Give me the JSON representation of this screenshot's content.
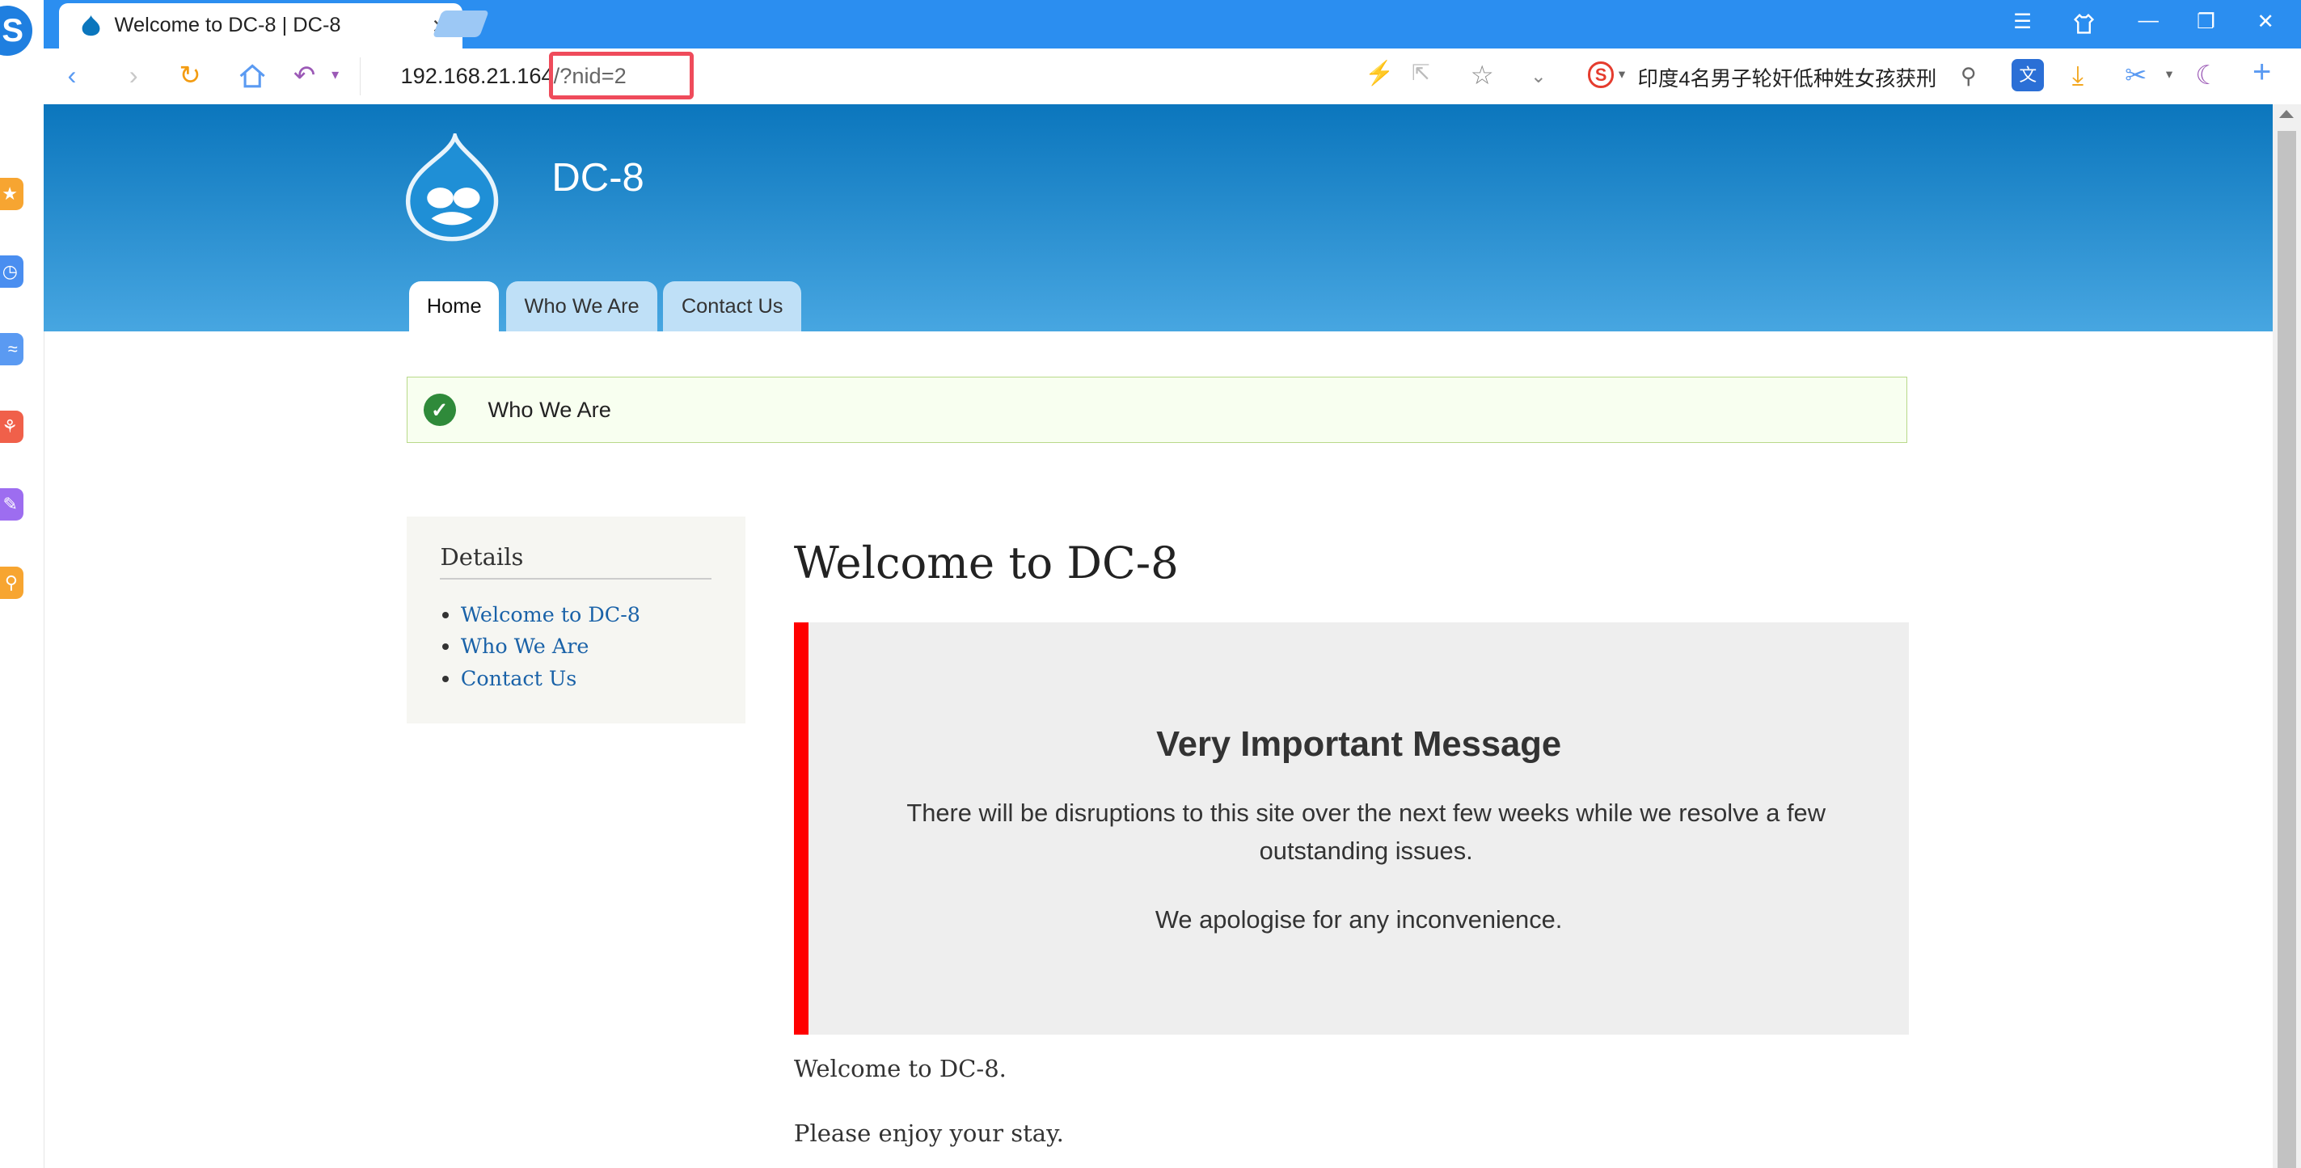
{
  "browser": {
    "tab_title": "Welcome to DC-8 | DC-8",
    "tab_close": "×",
    "url_host": "192.168.21.164",
    "url_query": "/?nid=2",
    "news_ticker": "印度4名男子轮奸低种姓女孩获刑",
    "sogou_letter": "S",
    "colors": {
      "tab_strip": "#2b8ef0",
      "highlight_box": "#ef4b5b"
    }
  },
  "site": {
    "name": "DC-8",
    "nav": [
      "Home",
      "Who We Are",
      "Contact Us"
    ],
    "active_nav": "Home",
    "status_message": "Who We Are"
  },
  "sidebar": {
    "title": "Details",
    "links": [
      "Welcome to DC-8",
      "Who We Are",
      "Contact Us"
    ]
  },
  "main": {
    "title": "Welcome to DC-8",
    "notice": {
      "heading": "Very Important Message",
      "line1": "There will be disruptions to this site over the next few weeks while we resolve a few outstanding issues.",
      "line2": "We apologise for any inconvenience."
    },
    "paragraph1": "Welcome to DC-8.",
    "paragraph2": "Please enjoy your stay."
  }
}
